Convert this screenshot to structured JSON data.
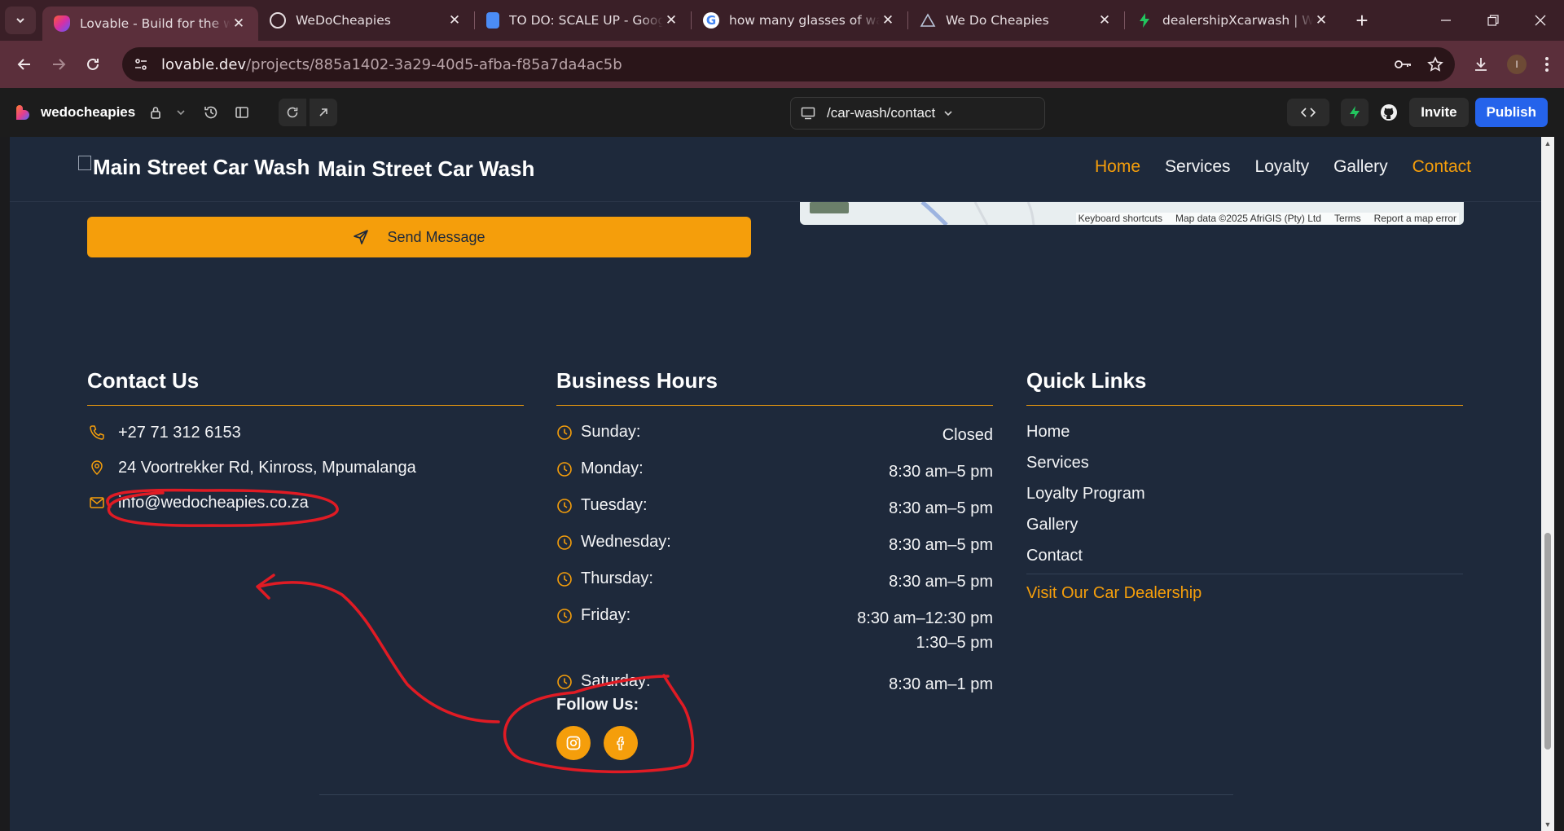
{
  "browser": {
    "tabs": [
      {
        "title": "Lovable - Build for the web",
        "favicon": "lovable-favicon",
        "active": true
      },
      {
        "title": "WeDoCheapies",
        "favicon": "openai-favicon"
      },
      {
        "title": "TO DO: SCALE UP - Google Docs",
        "favicon": "google-docs-favicon"
      },
      {
        "title": "how many glasses of water",
        "favicon": "google-favicon"
      },
      {
        "title": "We Do Cheapies",
        "favicon": "site-favicon"
      },
      {
        "title": "dealershipXcarwash | We Do Cheapies",
        "favicon": "bolt-favicon"
      }
    ],
    "url_host": "lovable.dev",
    "url_path": "/projects/885a1402-3a29-40d5-afba-f85a7da4ac5b",
    "profile_initial": "I"
  },
  "lovable": {
    "project_name": "wedocheapies",
    "route": "/car-wash/contact",
    "invite_label": "Invite",
    "publish_label": "Publish"
  },
  "site": {
    "logo_alt": "Main Street Car Wash",
    "brand_name": "Main Street Car Wash",
    "nav": [
      "Home",
      "Services",
      "Loyalty",
      "Gallery",
      "Contact"
    ],
    "send_label": "Send Message",
    "map_attrib": {
      "shortcuts": "Keyboard shortcuts",
      "data": "Map data ©2025 AfriGIS (Pty) Ltd",
      "terms": "Terms",
      "report": "Report a map error"
    },
    "contact": {
      "heading": "Contact Us",
      "phone": "+27 71 312 6153",
      "address": "24 Voortrekker Rd, Kinross, Mpumalanga",
      "email": "info@wedocheapies.co.za"
    },
    "hours": {
      "heading": "Business Hours",
      "rows": [
        {
          "day": "Sunday:",
          "time": "Closed"
        },
        {
          "day": "Monday:",
          "time": "8:30 am–5 pm"
        },
        {
          "day": "Tuesday:",
          "time": "8:30 am–5 pm"
        },
        {
          "day": "Wednesday:",
          "time": "8:30 am–5 pm"
        },
        {
          "day": "Thursday:",
          "time": "8:30 am–5 pm"
        },
        {
          "day": "Friday:",
          "time": "8:30 am–12:30 pm",
          "time2": "1:30–5 pm"
        },
        {
          "day": "Saturday:",
          "time": "8:30 am–1 pm"
        }
      ]
    },
    "quick_links": {
      "heading": "Quick Links",
      "links": [
        "Home",
        "Services",
        "Loyalty Program",
        "Gallery",
        "Contact"
      ],
      "dealer_link": "Visit Our Car Dealership"
    },
    "follow": {
      "label": "Follow Us:",
      "icons": [
        "instagram-icon",
        "facebook-icon"
      ]
    },
    "colors": {
      "accent": "#f59e0b",
      "background": "#1e293b",
      "annotation": "#e01b24"
    }
  }
}
